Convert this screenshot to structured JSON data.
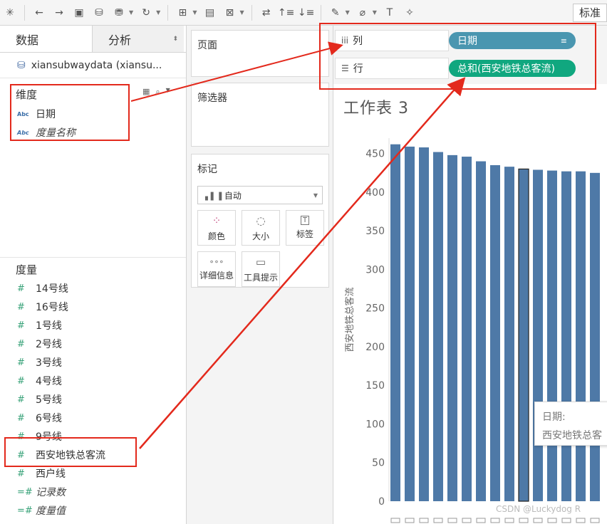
{
  "toolbar": {
    "standard_label": "标准"
  },
  "left_panel": {
    "tabs": [
      {
        "label": "数据"
      },
      {
        "label": "分析"
      }
    ],
    "datasource": "xiansubwaydata (xiansu...",
    "dimensions_title": "维度",
    "dimensions": [
      {
        "type": "Abc",
        "label": "日期",
        "italic": false
      },
      {
        "type": "Abc",
        "label": "度量名称",
        "italic": true
      }
    ],
    "measures_title": "度量",
    "measures": [
      {
        "label": "14号线",
        "italic": false
      },
      {
        "label": "16号线",
        "italic": false
      },
      {
        "label": "1号线",
        "italic": false
      },
      {
        "label": "2号线",
        "italic": false
      },
      {
        "label": "3号线",
        "italic": false
      },
      {
        "label": "4号线",
        "italic": false
      },
      {
        "label": "5号线",
        "italic": false
      },
      {
        "label": "6号线",
        "italic": false
      },
      {
        "label": "9号线",
        "italic": false
      },
      {
        "label": "西安地铁总客流",
        "italic": false
      },
      {
        "label": "西户线",
        "italic": false
      },
      {
        "label": "记录数",
        "italic": true
      },
      {
        "label": "度量值",
        "italic": true
      }
    ]
  },
  "cards": {
    "pages_title": "页面",
    "filters_title": "筛选器",
    "marks_title": "标记",
    "marks_type": "自动",
    "marks_buttons": [
      {
        "label": "颜色",
        "icon": "color-icon"
      },
      {
        "label": "大小",
        "icon": "size-icon"
      },
      {
        "label": "标签",
        "icon": "label-icon"
      },
      {
        "label": "详细信息",
        "icon": "detail-icon"
      },
      {
        "label": "工具提示",
        "icon": "tooltip-icon"
      }
    ]
  },
  "shelves": {
    "columns_label": "列",
    "rows_label": "行",
    "columns_pill": "日期",
    "rows_pill": "总和(西安地铁总客流)",
    "columns_pill_color": "#4a96b0",
    "rows_pill_color": "#10a77f"
  },
  "sheet": {
    "title": "工作表 3",
    "tooltip_line1": "日期:",
    "tooltip_line2": "西安地铁总客",
    "watermark": "CSDN @Luckydog R"
  },
  "chart_data": {
    "type": "bar",
    "ylabel": "西安地铁总客流",
    "ylim": [
      0,
      470
    ],
    "yticks": [
      0,
      50,
      100,
      150,
      200,
      250,
      300,
      350,
      400,
      450
    ],
    "categories": [
      "",
      "",
      "",
      "",
      "",
      "",
      "",
      "",
      "",
      "",
      "",
      "",
      "",
      "",
      ""
    ],
    "values": [
      462,
      459,
      458,
      452,
      448,
      446,
      440,
      435,
      433,
      430,
      429,
      428,
      427,
      427,
      425
    ],
    "highlight_index": 9,
    "bar_color": "#4e79a7"
  },
  "accent": {
    "annotation_red": "#e3291c"
  }
}
